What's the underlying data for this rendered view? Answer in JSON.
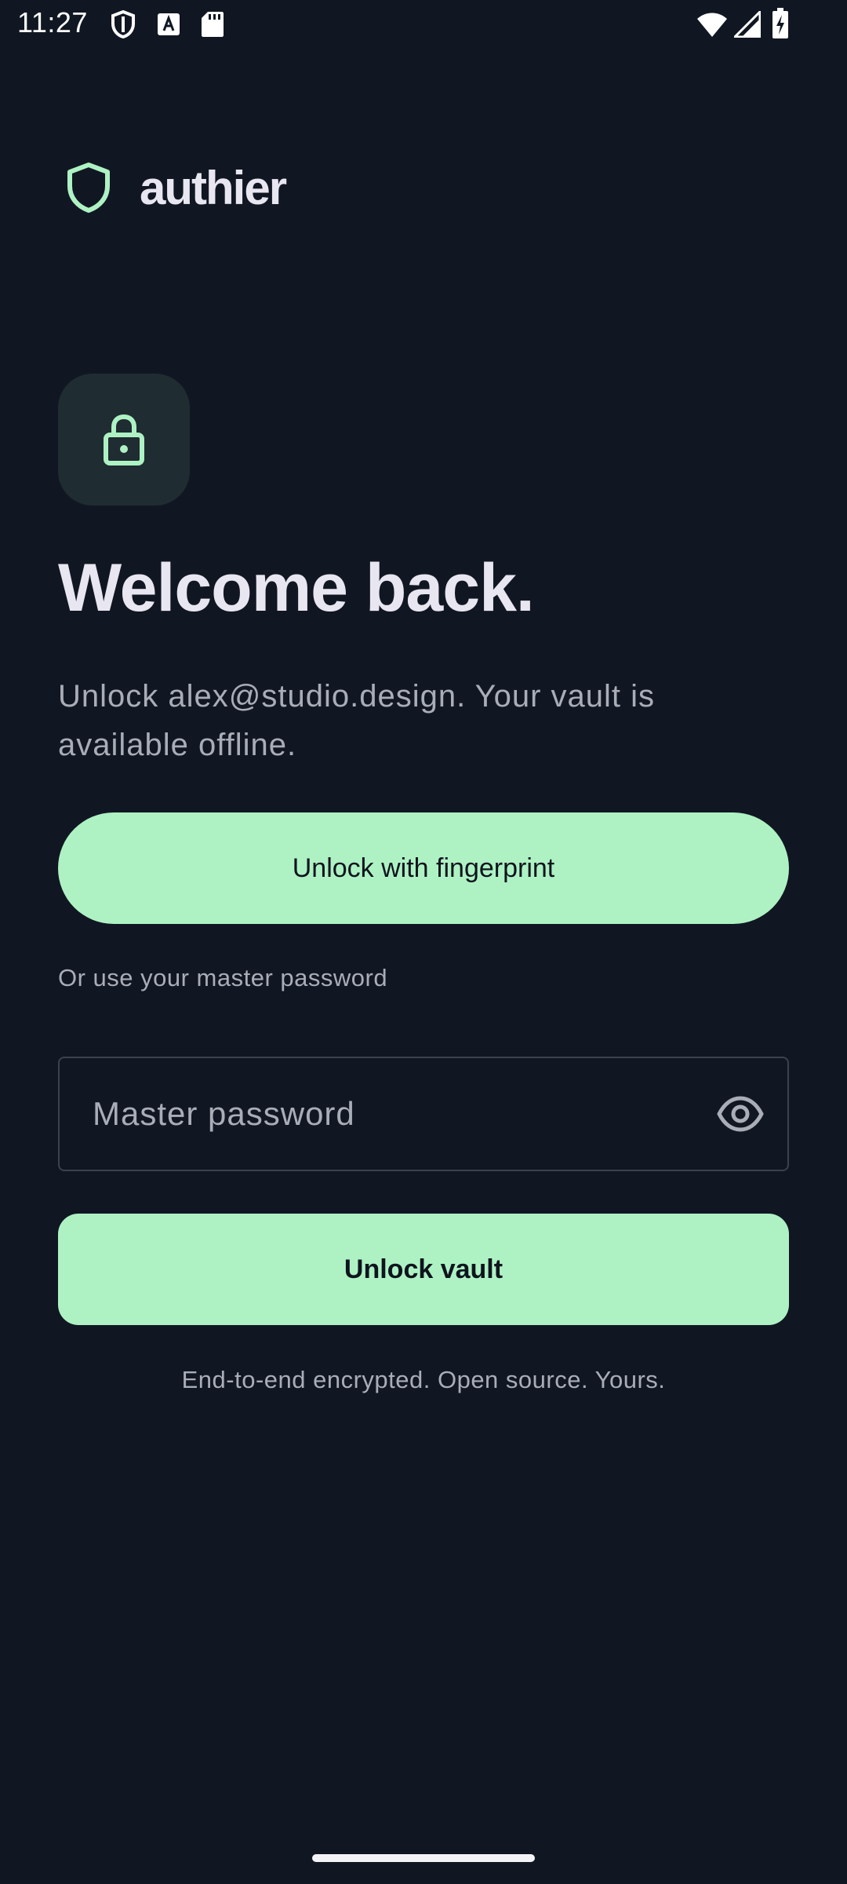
{
  "status_bar": {
    "time": "11:27",
    "left_icons": [
      "shield-outline-icon",
      "font-a-icon",
      "sd-card-icon"
    ],
    "right_icons": [
      "wifi-icon",
      "cellular-signal-icon",
      "battery-charging-icon"
    ]
  },
  "brand": {
    "name": "authier",
    "logo_icon": "shield-icon",
    "accent_color": "#aef2c4"
  },
  "hero": {
    "icon": "lock-icon",
    "title": "Welcome back.",
    "subtitle": "Unlock alex@studio.design. Your vault is available offline."
  },
  "actions": {
    "fingerprint_label": "Unlock with fingerprint",
    "or_text": "Or use your master password",
    "unlock_label": "Unlock vault"
  },
  "password": {
    "placeholder": "Master password",
    "value": "",
    "toggle_icon": "eye-icon"
  },
  "footer": {
    "note": "End-to-end encrypted. Open source. Yours."
  },
  "colors": {
    "background": "#111722",
    "accent": "#aef2c4",
    "text_primary": "#e8e6f0",
    "text_secondary": "#a9adb8"
  }
}
